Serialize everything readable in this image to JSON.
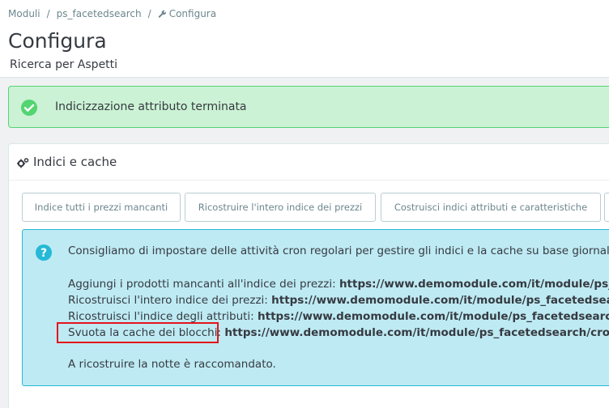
{
  "breadcrumb": {
    "items": [
      "Moduli",
      "ps_facetedsearch"
    ],
    "current": "Configura"
  },
  "header": {
    "title": "Configura",
    "subtitle": "Ricerca per Aspetti"
  },
  "success_alert": {
    "message": "Indicizzazione attributo terminata"
  },
  "panel": {
    "title": "Indici e cache",
    "buttons": [
      "Indice tutti i prezzi mancanti",
      "Ricostruire l'intero indice dei prezzi",
      "Costruisci indici attributi e caratteristiche"
    ]
  },
  "info": {
    "intro": "Consigliamo di impostare delle attività cron regolari per gestire gli indici e la cache su base giornaliera/se",
    "lines": [
      {
        "label": "Aggiungi i prodotti mancanti all'indice dei prezzi: ",
        "url": "https://www.demomodule.com/it/module/ps_facetedsearch/c"
      },
      {
        "label": "Ricostruisci l'intero indice dei prezzi: ",
        "url": "https://www.demomodule.com/it/module/ps_facetedsearch/cr"
      },
      {
        "label": "Ricostruisci l'indice degli attributi: ",
        "url": "https://www.demomodule.com/it/module/ps_facetedsearch/cron"
      },
      {
        "label": "Svuota la cache dei blocchi: ",
        "url": "https://www.demomodule.com/it/module/ps_facetedsearch/cron?ajax"
      }
    ],
    "footer": "A ricostruire la notte è raccomandato."
  },
  "colors": {
    "success_bg": "#cbf2d4",
    "success_border": "#53d572",
    "info_bg": "#beeaf3",
    "info_border": "#25b9d7",
    "highlight": "#e5141b"
  }
}
